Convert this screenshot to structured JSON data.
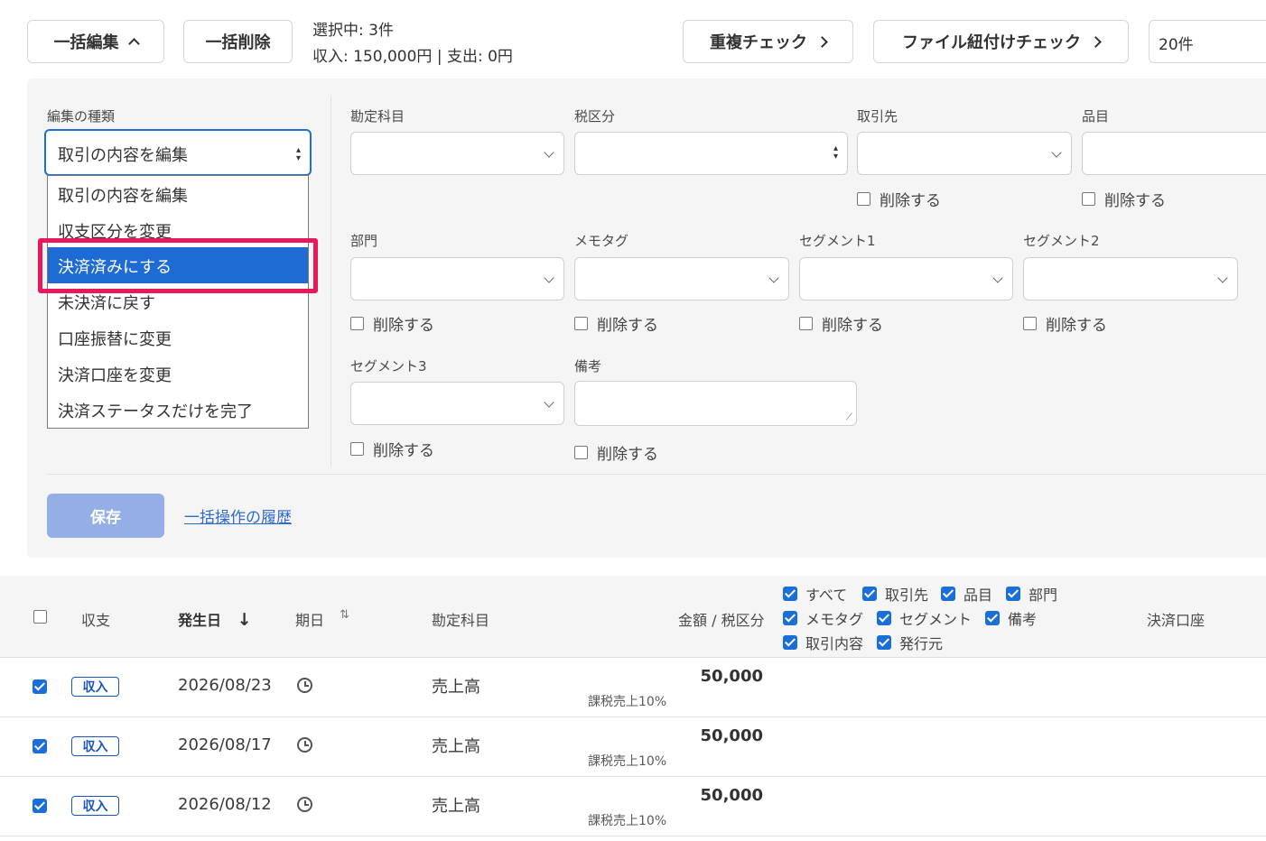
{
  "toolbar": {
    "bulk_edit": "一括編集",
    "bulk_delete": "一括削除",
    "selection_count": "選択中: 3件",
    "selection_sum": "収入: 150,000円 | 支出: 0円",
    "duplicate_check": "重複チェック",
    "file_link_check": "ファイル紐付けチェック",
    "per_page": "20件"
  },
  "edit_panel": {
    "edit_type_label": "編集の種類",
    "edit_type_value": "取引の内容を編集",
    "edit_type_options": [
      "取引の内容を編集",
      "収支区分を変更",
      "決済済みにする",
      "未決済に戻す",
      "口座振替に変更",
      "決済口座を変更",
      "決済ステータスだけを完了"
    ],
    "highlighted_option_index": 2,
    "fields": {
      "account": "勘定科目",
      "tax_class": "税区分",
      "partner": "取引先",
      "item": "品目",
      "department": "部門",
      "memo_tag": "メモタグ",
      "segment1": "セグメント1",
      "segment2": "セグメント2",
      "segment3": "セグメント3",
      "remarks": "備考"
    },
    "delete_label": "削除する",
    "save_label": "保存",
    "history_link": "一括操作の履歴"
  },
  "table": {
    "headers": {
      "type": "収支",
      "issue_date": "発生日",
      "due_date": "期日",
      "account": "勘定科目",
      "amount_tax": "金額 / 税区分",
      "payment_account": "決済口座"
    },
    "column_toggles": [
      "すべて",
      "取引先",
      "品目",
      "部門",
      "メモタグ",
      "セグメント",
      "備考",
      "取引内容",
      "発行元"
    ],
    "rows": [
      {
        "type": "収入",
        "date": "2026/08/23",
        "account": "売上高",
        "amount": "50,000",
        "tax": "課税売上10%"
      },
      {
        "type": "収入",
        "date": "2026/08/17",
        "account": "売上高",
        "amount": "50,000",
        "tax": "課税売上10%"
      },
      {
        "type": "収入",
        "date": "2026/08/12",
        "account": "売上高",
        "amount": "50,000",
        "tax": "課税売上10%"
      }
    ]
  },
  "colors": {
    "primary_blue": "#1f6bd4",
    "highlight_red": "#e8185a",
    "save_disabled": "#94aee6",
    "panel_bg": "#f6f5f6"
  }
}
